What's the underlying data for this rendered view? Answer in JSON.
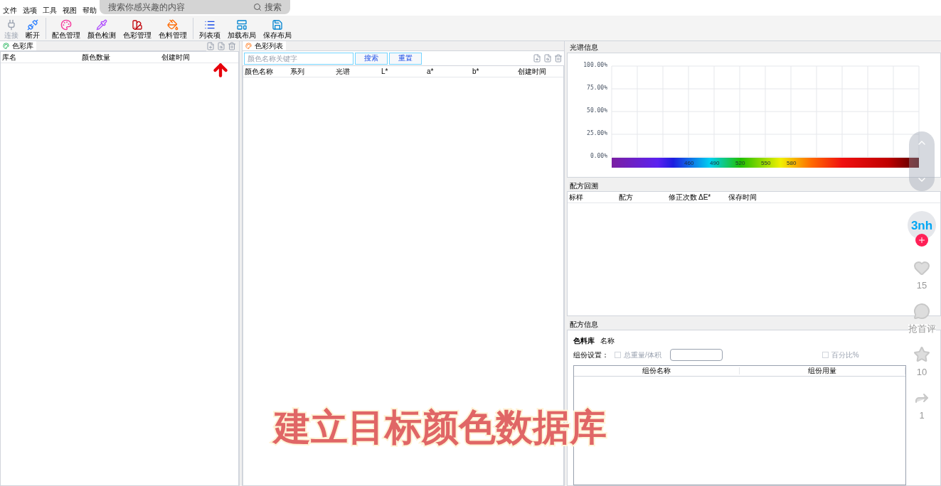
{
  "menu": [
    "文件",
    "选项",
    "工具",
    "视图",
    "帮助"
  ],
  "top_search": {
    "placeholder": "搜索你感兴趣的内容",
    "button": "搜索"
  },
  "toolbar": [
    {
      "label": "连接",
      "disabled": true
    },
    {
      "label": "断开",
      "disabled": false
    },
    {
      "label": "配色管理",
      "disabled": false
    },
    {
      "label": "颜色检测",
      "disabled": false
    },
    {
      "label": "色彩管理",
      "disabled": false
    },
    {
      "label": "色料管理",
      "disabled": false
    },
    {
      "label": "列表项",
      "disabled": false
    },
    {
      "label": "加载布局",
      "disabled": false
    },
    {
      "label": "保存布局",
      "disabled": false
    }
  ],
  "library_panel": {
    "tab": "色彩库",
    "columns": [
      "库名",
      "颜色数量",
      "创建时间"
    ]
  },
  "color_list_panel": {
    "tab": "色彩列表",
    "search_placeholder": "颜色名称关键字",
    "buttons": [
      "搜索",
      "重置"
    ],
    "columns": [
      "颜色名称",
      "系列",
      "光谱",
      "L*",
      "a*",
      "b*",
      "创建时间"
    ]
  },
  "spectrum_panel": {
    "title": "光谱信息",
    "y_labels": [
      "100.00%",
      "75.00%",
      "50.00%",
      "25.00%",
      "0.00%"
    ],
    "wavelength_labels": [
      "460",
      "490",
      "520",
      "550",
      "580"
    ]
  },
  "recipe_trace_panel": {
    "title": "配方回溯",
    "columns": [
      "标样",
      "配方",
      "修正次数",
      "ΔE*",
      "保存时间"
    ]
  },
  "recipe_info_panel": {
    "title": "配方信息",
    "library_label": "色料库",
    "name_label": "名称",
    "component_label": "组份设置：",
    "checkboxes": [
      {
        "label": "总重量/体积",
        "checked": false,
        "disabled": true
      },
      {
        "label": "百分比%",
        "checked": false,
        "disabled": true
      }
    ],
    "columns": [
      "组份名称",
      "组份用量"
    ]
  },
  "video_overlay": {
    "caption": "建立目标颜色数据库",
    "avatar_text": "3nh",
    "actions": [
      {
        "kind": "like",
        "text": "15"
      },
      {
        "kind": "comment",
        "text": "抢首评"
      },
      {
        "kind": "favorite",
        "text": "10"
      },
      {
        "kind": "share",
        "text": "1"
      }
    ]
  }
}
